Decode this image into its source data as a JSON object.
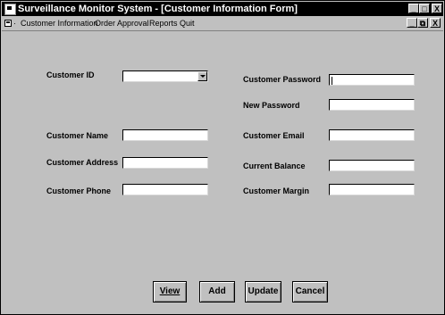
{
  "window": {
    "title": "Surveillance Monitor System - [Customer Information Form]",
    "controls": {
      "minimize": "_",
      "maximize": "□",
      "close": "X"
    },
    "child_controls": {
      "minimize": "_",
      "restore": "⧉",
      "close": "X"
    }
  },
  "menu": {
    "items": [
      {
        "label": "Customer Information"
      },
      {
        "label": "Order Approval"
      },
      {
        "label": "Reports"
      },
      {
        "label": "Quit"
      }
    ]
  },
  "form": {
    "customer_id": {
      "label": "Customer ID",
      "value": ""
    },
    "customer_name": {
      "label": "Customer Name",
      "value": ""
    },
    "customer_address": {
      "label": "Customer Address",
      "value": ""
    },
    "customer_phone": {
      "label": "Customer Phone",
      "value": ""
    },
    "customer_password": {
      "label": "Customer Password",
      "value": ""
    },
    "new_password": {
      "label": "New Password",
      "value": ""
    },
    "customer_email": {
      "label": "Customer Email",
      "value": ""
    },
    "current_balance": {
      "label": "Current Balance",
      "value": ""
    },
    "customer_margin": {
      "label": "Customer Margin",
      "value": ""
    }
  },
  "buttons": {
    "view": "View",
    "add": "Add",
    "update": "Update",
    "cancel": "Cancel"
  }
}
